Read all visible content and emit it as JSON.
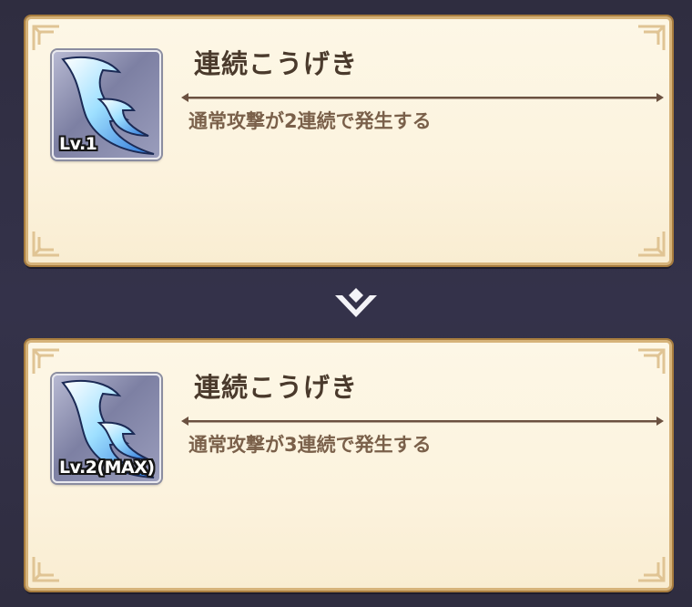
{
  "skills": [
    {
      "title": "連続こうげき",
      "level": "Lv.1",
      "description": "通常攻撃が2連続で発生する"
    },
    {
      "title": "連続こうげき",
      "level": "Lv.2(MAX)",
      "description": "通常攻撃が3連続で発生する"
    }
  ],
  "icons": {
    "skill_icon": "claw-slash-icon",
    "transition": "chevron-down-icon"
  },
  "colors": {
    "background": "#2f2d40",
    "card": "#fcf3de",
    "card_border": "#d6b37a",
    "title": "#4a3a2c",
    "description": "#7a604a"
  }
}
